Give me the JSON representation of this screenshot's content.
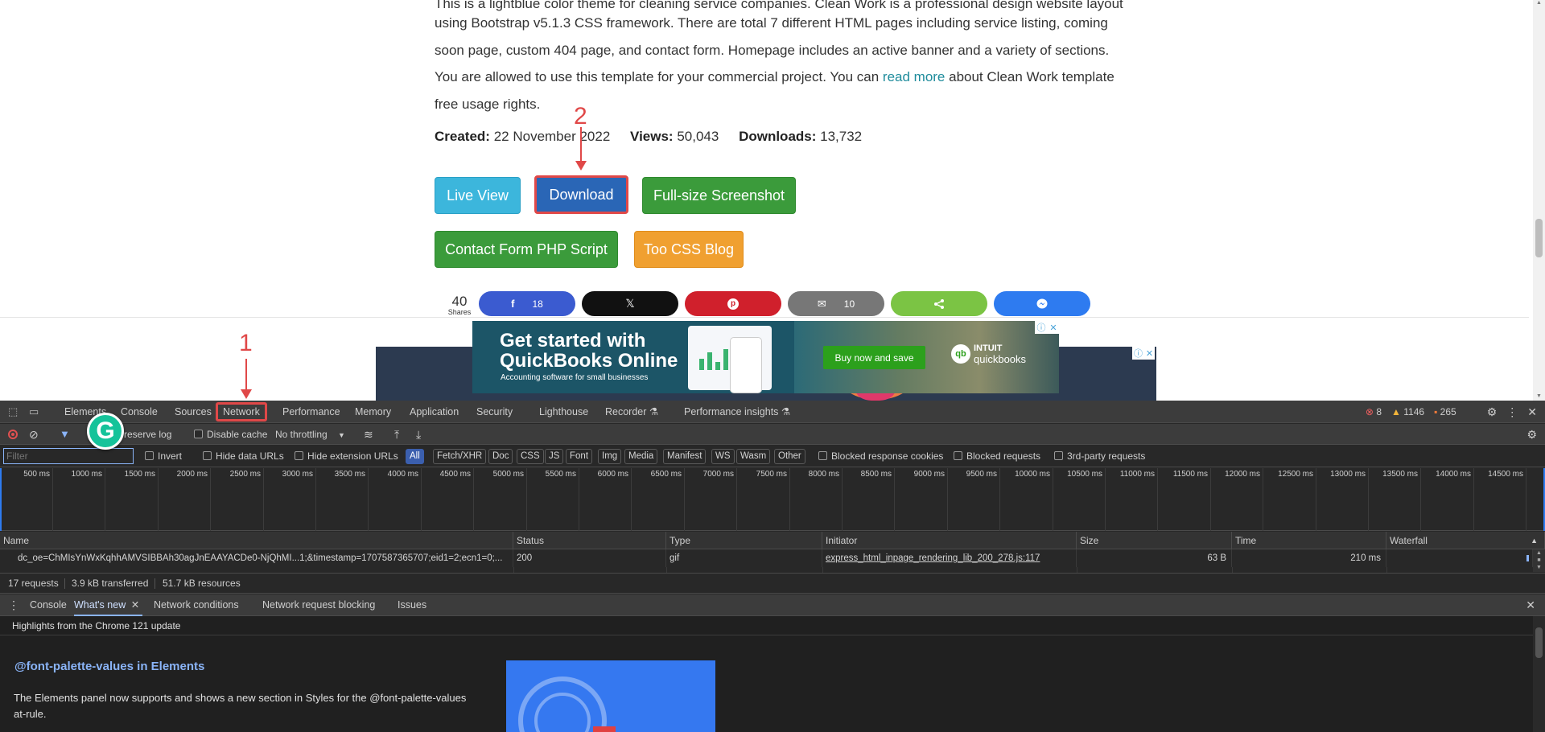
{
  "article": {
    "line0": "This is a lightblue color theme for cleaning service companies. Clean Work is a professional design website layout",
    "line1": "using Bootstrap v5.1.3 CSS framework. There are total 7 different HTML pages including service listing, coming",
    "line2": "soon page, custom 404 page, and contact form. Homepage includes an active banner and a variety of sections.",
    "line3_prefix": "You are allowed to use this template for your commercial project. You can ",
    "line3_link": "read more",
    "line3_suffix": " about Clean Work template",
    "line4": "free usage rights."
  },
  "meta": {
    "created_label": "Created:",
    "created_value": "22 November 2022",
    "views_label": "Views:",
    "views_value": "50,043",
    "downloads_label": "Downloads:",
    "downloads_value": "13,732"
  },
  "buttons": {
    "live_view": "Live View",
    "download": "Download",
    "full_size": "Full-size Screenshot",
    "contact_form": "Contact Form PHP Script",
    "blog": "Too CSS Blog"
  },
  "share": {
    "count": "40",
    "label": "Shares",
    "facebook_count": "18",
    "email_count": "10"
  },
  "ad": {
    "headline_1": "Get started with",
    "headline_2": "QuickBooks Online",
    "sub": "Accounting software for small businesses",
    "cta": "Buy now and save",
    "brand_1": "INTUIT",
    "brand_2": "quickbooks",
    "brand_mark": "qb"
  },
  "annotations": {
    "step1": "1",
    "step2": "2",
    "color": "#e04848"
  },
  "devtools": {
    "tabs": [
      "Elements",
      "Console",
      "Sources",
      "Network",
      "Performance",
      "Memory",
      "Application",
      "Security",
      "Lighthouse",
      "Recorder ⚗",
      "Performance insights ⚗"
    ],
    "selected_tab": "Network",
    "errors": "8",
    "warnings": "1146",
    "issues": "265",
    "toolbar": {
      "preserve_log": "Preserve log",
      "disable_cache": "Disable cache",
      "throttling": "No throttling"
    },
    "filter": {
      "placeholder": "Filter",
      "invert": "Invert",
      "hide_data_urls": "Hide data URLs",
      "hide_ext_urls": "Hide extension URLs",
      "chips": [
        "All",
        "Fetch/XHR",
        "Doc",
        "CSS",
        "JS",
        "Font",
        "Img",
        "Media",
        "Manifest",
        "WS",
        "Wasm",
        "Other"
      ],
      "blocked_cookies": "Blocked response cookies",
      "blocked_requests": "Blocked requests",
      "third_party": "3rd-party requests"
    },
    "timeline_ticks": [
      "500 ms",
      "1000 ms",
      "1500 ms",
      "2000 ms",
      "2500 ms",
      "3000 ms",
      "3500 ms",
      "4000 ms",
      "4500 ms",
      "5000 ms",
      "5500 ms",
      "6000 ms",
      "6500 ms",
      "7000 ms",
      "7500 ms",
      "8000 ms",
      "8500 ms",
      "9000 ms",
      "9500 ms",
      "10000 ms",
      "10500 ms",
      "11000 ms",
      "11500 ms",
      "12000 ms",
      "12500 ms",
      "13000 ms",
      "13500 ms",
      "14000 ms",
      "14500 ms"
    ],
    "table": {
      "headers": [
        "Name",
        "Status",
        "Type",
        "Initiator",
        "Size",
        "Time",
        "Waterfall"
      ],
      "row": {
        "name": "dc_oe=ChMIsYnWxKqhhAMVSIBBAh30agJnEAAYACDe0-NjQhMI...1;&timestamp=1707587365707;eid1=2;ecn1=0;...",
        "status": "200",
        "type": "gif",
        "initiator": "express_html_inpage_rendering_lib_200_278.js:117",
        "size": "63 B",
        "time": "210 ms"
      }
    },
    "status": {
      "requests": "17 requests",
      "transferred": "3.9 kB transferred",
      "resources": "51.7 kB resources"
    },
    "drawer_tabs": [
      "Console",
      "What's new",
      "Network conditions",
      "Network request blocking",
      "Issues"
    ],
    "drawer_selected": "What's new",
    "whats_new": {
      "header": "Highlights from the Chrome 121 update",
      "title": "@font-palette-values in Elements",
      "desc": "The Elements panel now supports and shows a new section in Styles for the @font-palette-values at-rule."
    }
  }
}
